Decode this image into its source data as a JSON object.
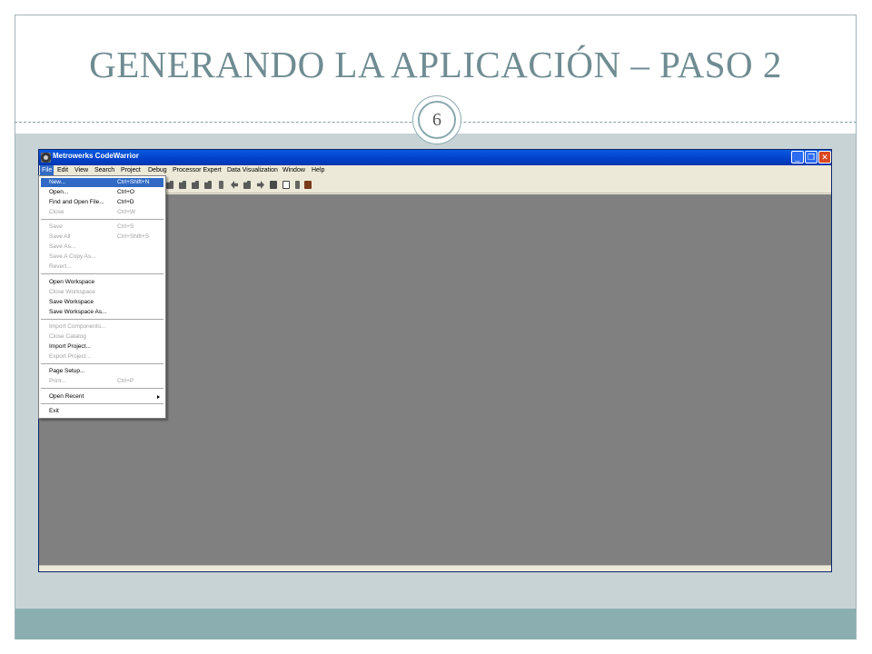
{
  "slide": {
    "title": "GENERANDO LA APLICACIÓN – PASO 2",
    "page_number": "6"
  },
  "window": {
    "title": "Metrowerks CodeWarrior",
    "controls": {
      "minimize_icon": "minimize-icon",
      "restore_icon": "restore-icon",
      "close_icon": "close-icon"
    }
  },
  "menu_bar": [
    "File",
    "Edit",
    "View",
    "Search",
    "Project",
    "Debug",
    "Processor Expert",
    "Data Visualization",
    "Window",
    "Help"
  ],
  "file_menu": {
    "new": {
      "label": "New...",
      "shortcut": "Ctrl+Shift+N"
    },
    "open": {
      "label": "Open...",
      "shortcut": "Ctrl+O"
    },
    "find_open": {
      "label": "Find and Open File...",
      "shortcut": "Ctrl+D"
    },
    "close": {
      "label": "Close",
      "shortcut": "Ctrl+W"
    },
    "save": {
      "label": "Save",
      "shortcut": "Ctrl+S"
    },
    "save_all": {
      "label": "Save All",
      "shortcut": "Ctrl+Shift+S"
    },
    "save_as": {
      "label": "Save As..."
    },
    "save_copy_as": {
      "label": "Save A Copy As..."
    },
    "revert": {
      "label": "Revert..."
    },
    "open_workspace": {
      "label": "Open Workspace"
    },
    "close_workspace": {
      "label": "Close Workspace"
    },
    "save_workspace": {
      "label": "Save Workspace"
    },
    "save_workspace_as": {
      "label": "Save Workspace As..."
    },
    "import_components": {
      "label": "Import Components..."
    },
    "close_catalog": {
      "label": "Close Catalog"
    },
    "import_project": {
      "label": "Import Project..."
    },
    "export_project": {
      "label": "Export Project..."
    },
    "page_setup": {
      "label": "Page Setup..."
    },
    "print": {
      "label": "Print...",
      "shortcut": "Ctrl+P"
    },
    "open_recent": {
      "label": "Open Recent"
    },
    "exit": {
      "label": "Exit"
    }
  },
  "colors": {
    "title_color": "#6f8c92",
    "band_color": "#c8d3d5",
    "footer_color": "#8bafb1",
    "highlight": "#316ac5"
  }
}
